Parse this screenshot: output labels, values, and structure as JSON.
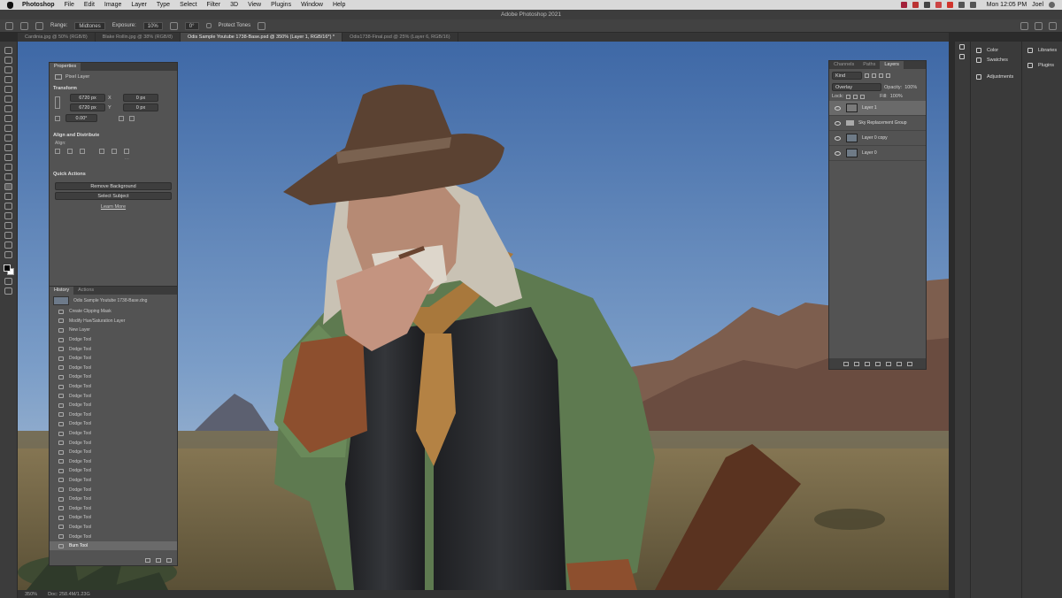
{
  "menubar": {
    "app": "Photoshop",
    "items": [
      "File",
      "Edit",
      "Image",
      "Layer",
      "Type",
      "Select",
      "Filter",
      "3D",
      "View",
      "Plugins",
      "Window",
      "Help"
    ],
    "clock": "Mon 12:05 PM",
    "user": "Joel"
  },
  "window_title": "Adobe Photoshop 2021",
  "options": {
    "range_label": "Range:",
    "range_value": "Midtones",
    "exposure_label": "Exposure:",
    "exposure_value": "10%",
    "angle_value": "0°",
    "protect_tones": "Protect Tones"
  },
  "tabs": [
    "Cardinia.jpg @ 50% (RGB/8)",
    "Blake Rollin.jpg @ 38% (RGB/8)",
    "Odis Sample Youtube 1738-Base.psd @ 350% (Layer 1, RGB/16*) *",
    "Odis1738-Final.psd @ 25% (Layer 6, RGB/16)"
  ],
  "properties": {
    "tab": "Properties",
    "layer_type": "Pixel Layer",
    "transform_label": "Transform",
    "w": "6720 px",
    "h": "6720 px",
    "x": "0 px",
    "y": "0 px",
    "angle": "0.00°",
    "align_label": "Align and Distribute",
    "align_sub": "Align:",
    "quick_label": "Quick Actions",
    "remove_bg": "Remove Background",
    "select_subject": "Select Subject",
    "learn_more": "Learn More"
  },
  "history": {
    "tabs": [
      "History",
      "Actions"
    ],
    "snapshot": "Odis Sample Youtube 1738-Base.dng",
    "items": [
      "Create Clipping Mask",
      "Modify Hue/Saturation Layer",
      "New Layer",
      "Dodge Tool",
      "Dodge Tool",
      "Dodge Tool",
      "Dodge Tool",
      "Dodge Tool",
      "Dodge Tool",
      "Dodge Tool",
      "Dodge Tool",
      "Dodge Tool",
      "Dodge Tool",
      "Dodge Tool",
      "Dodge Tool",
      "Dodge Tool",
      "Dodge Tool",
      "Dodge Tool",
      "Dodge Tool",
      "Dodge Tool",
      "Dodge Tool",
      "Dodge Tool",
      "Dodge Tool",
      "Dodge Tool",
      "Dodge Tool",
      "Burn Tool"
    ]
  },
  "layers": {
    "tabs": [
      "Channels",
      "Paths",
      "Layers"
    ],
    "kind": "Kind",
    "blend": "Overlay",
    "opacity_label": "Opacity:",
    "opacity": "100%",
    "lock_label": "Lock:",
    "fill_label": "Fill:",
    "fill": "100%",
    "items": [
      "Layer 1",
      "Sky Replacement Group",
      "Layer 0 copy",
      "Layer 0"
    ]
  },
  "dock": {
    "col1": [
      "Color",
      "Swatches",
      "Adjustments"
    ],
    "col2": [
      "Libraries",
      "Plugins"
    ]
  },
  "status": {
    "zoom": "350%",
    "doc": "Doc: 258.4M/1.23G"
  },
  "colors": {
    "panel": "#535353",
    "sky_top": "#3f69a8",
    "sky_bottom": "#9fb8d2"
  }
}
